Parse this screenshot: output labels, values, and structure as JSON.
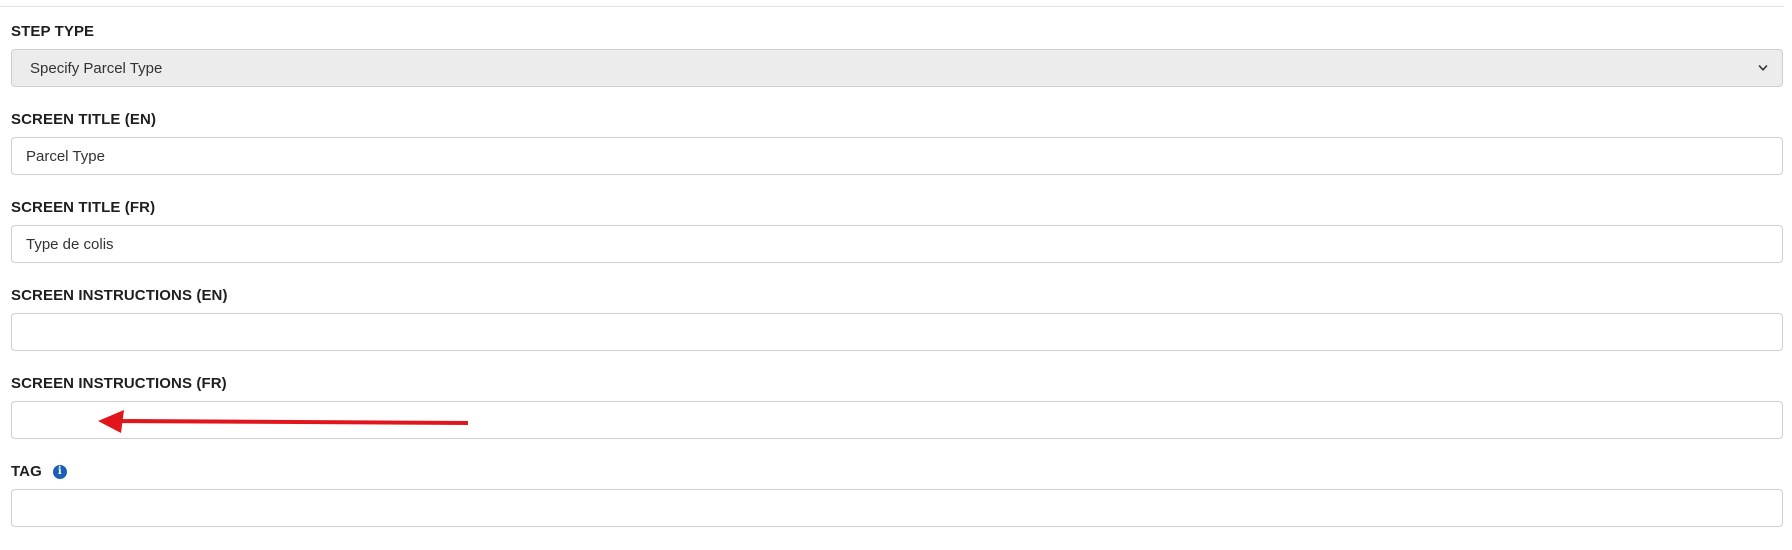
{
  "form": {
    "step_type": {
      "label": "STEP TYPE",
      "value": "Specify Parcel Type"
    },
    "screen_title_en": {
      "label": "SCREEN TITLE (EN)",
      "value": "Parcel Type"
    },
    "screen_title_fr": {
      "label": "SCREEN TITLE (FR)",
      "value": "Type de colis"
    },
    "screen_instructions_en": {
      "label": "SCREEN INSTRUCTIONS (EN)",
      "value": ""
    },
    "screen_instructions_fr": {
      "label": "SCREEN INSTRUCTIONS (FR)",
      "value": ""
    },
    "tag": {
      "label": "TAG",
      "value": "",
      "info_icon": "info-circle-icon",
      "info_glyph": "i"
    }
  },
  "annotation": {
    "arrow_color": "#e0161c"
  },
  "colors": {
    "info_icon": "#1a5fb4",
    "select_background": "#ececec",
    "field_border": "#cfcfcf"
  }
}
